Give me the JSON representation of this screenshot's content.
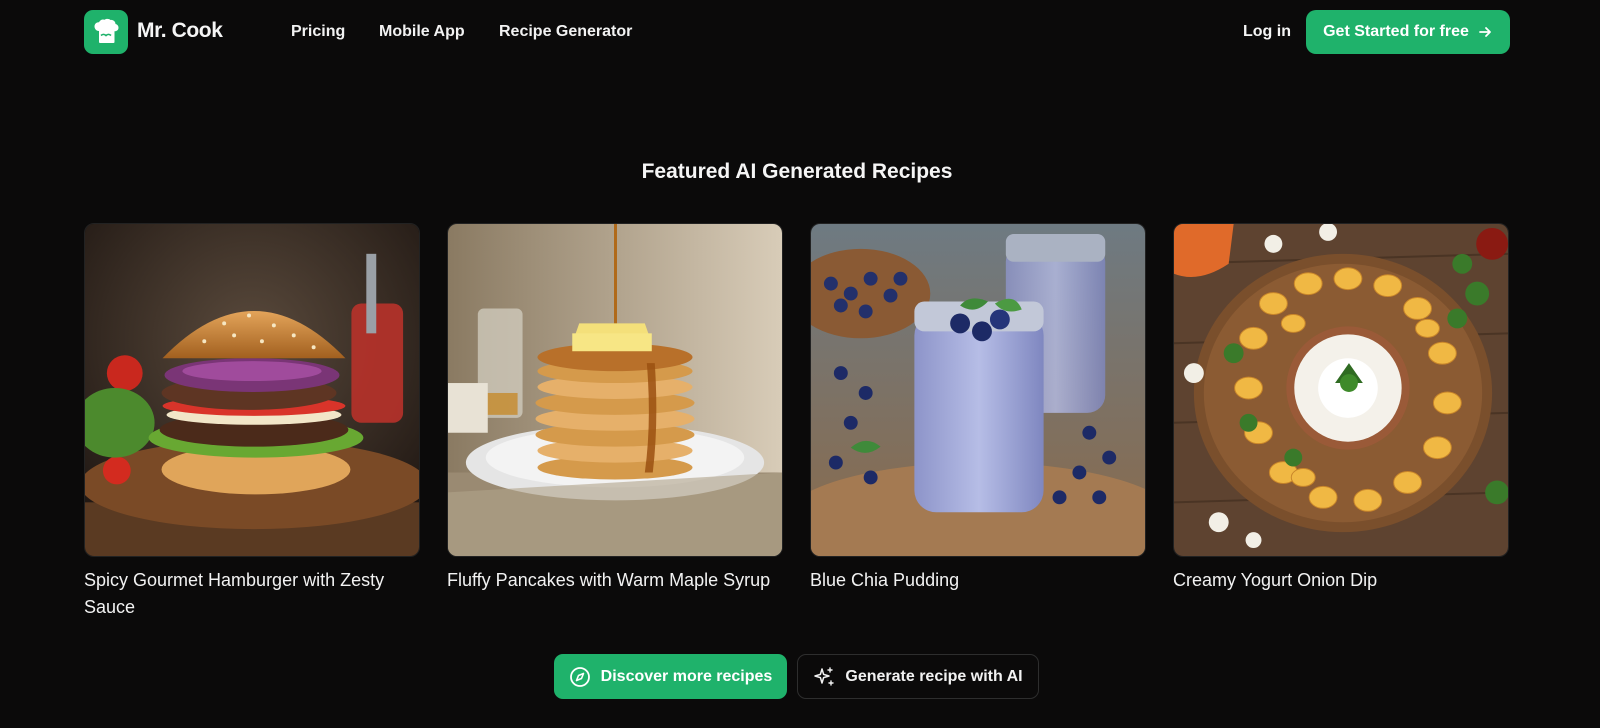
{
  "header": {
    "brand": "Mr. Cook",
    "logo_icon": "chef-hat-icon",
    "nav": [
      {
        "label": "Pricing"
      },
      {
        "label": "Mobile App"
      },
      {
        "label": "Recipe Generator"
      }
    ],
    "login_label": "Log in",
    "cta_label": "Get Started for free",
    "cta_icon": "arrow-right-icon"
  },
  "main": {
    "section_title": "Featured AI Generated Recipes",
    "recipes": [
      {
        "title": "Spicy Gourmet Hamburger with Zesty Sauce",
        "image": "hamburger-photo"
      },
      {
        "title": "Fluffy Pancakes with Warm Maple Syrup",
        "image": "pancakes-photo"
      },
      {
        "title": "Blue Chia Pudding",
        "image": "blueberry-pudding-photo"
      },
      {
        "title": "Creamy Yogurt Onion Dip",
        "image": "yogurt-dip-photo"
      }
    ],
    "discover_label": "Discover more recipes",
    "discover_icon": "compass-icon",
    "generate_label": "Generate recipe with AI",
    "generate_icon": "sparkles-icon"
  },
  "colors": {
    "background": "#0b0a0a",
    "accent": "#1fb26b",
    "text": "#f5f5f5"
  }
}
